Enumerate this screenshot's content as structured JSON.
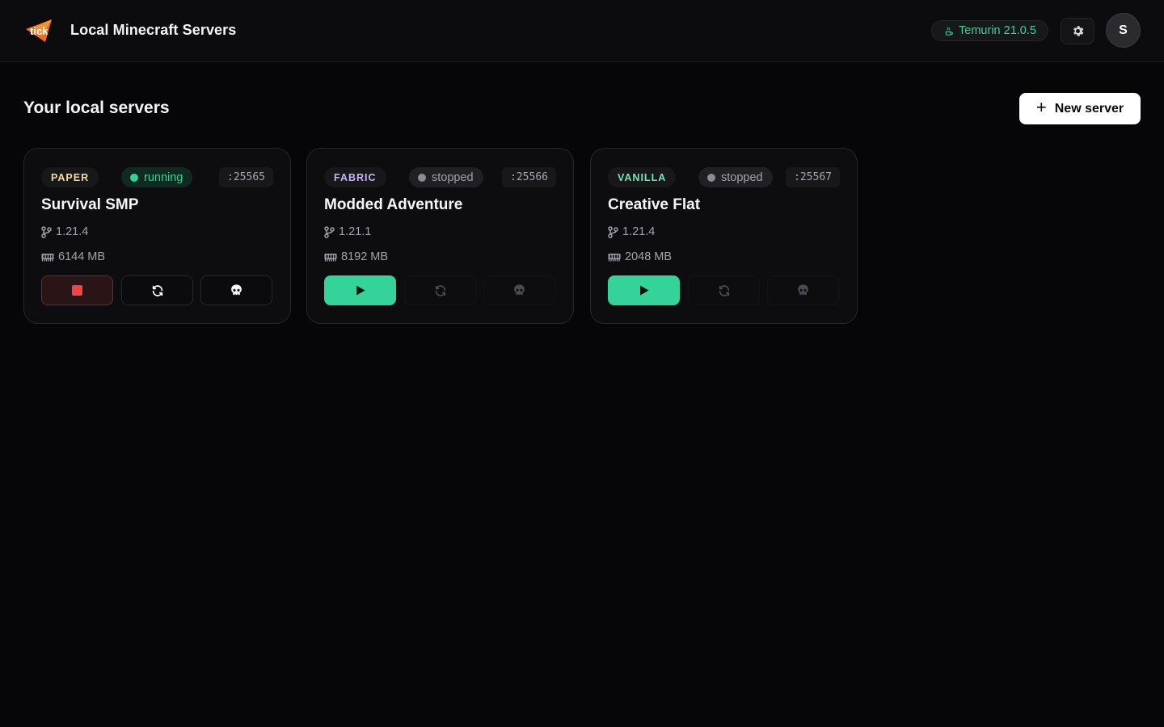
{
  "header": {
    "title": "Local Minecraft Servers",
    "logo_text": "tick",
    "java_version": "Temurin 21.0.5",
    "avatar_initial": "S"
  },
  "main": {
    "section_title": "Your local servers",
    "new_server_label": "New server",
    "servers": [
      {
        "type": "PAPER",
        "type_color": "#f3dd9a",
        "status": "running",
        "status_color": "#34d399",
        "port": ":25565",
        "name": "Survival SMP",
        "version": "1.21.4",
        "memory": "6144 MB",
        "primary_action": "stop"
      },
      {
        "type": "FABRIC",
        "type_color": "#c4b5fd",
        "status": "stopped",
        "status_color": "#a1a1aa",
        "port": ":25566",
        "name": "Modded Adventure",
        "version": "1.21.1",
        "memory": "8192 MB",
        "primary_action": "start"
      },
      {
        "type": "VANILLA",
        "type_color": "#6ee7b7",
        "status": "stopped",
        "status_color": "#a1a1aa",
        "port": ":25567",
        "name": "Creative Flat",
        "version": "1.21.4",
        "memory": "2048 MB",
        "primary_action": "start"
      }
    ]
  },
  "icons": {
    "java": "coffee-icon",
    "settings": "gear-icon",
    "version": "git-branch-icon",
    "memory": "memory-icon",
    "stop": "stop-icon",
    "start": "play-icon",
    "restart": "refresh-icon",
    "kill": "skull-icon"
  },
  "colors": {
    "accent": "#34d399",
    "danger": "#ef4444",
    "background": "#060608",
    "card": "#0d0d10"
  }
}
